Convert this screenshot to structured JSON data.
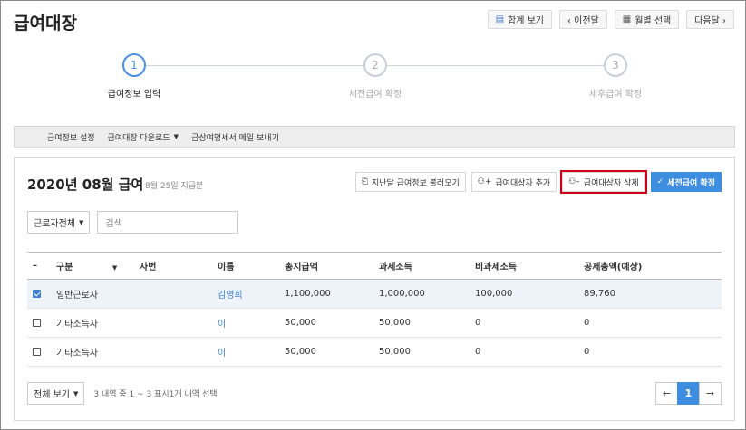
{
  "header": {
    "title": "급여대장",
    "actions": [
      {
        "label": "합계 보기",
        "icon": "sum-icon"
      },
      {
        "label": "‹ 이전달",
        "icon": ""
      },
      {
        "label": "월별 선택",
        "icon": "calendar-icon"
      },
      {
        "label": "다음달 ›",
        "icon": ""
      }
    ]
  },
  "steps": [
    {
      "num": "1",
      "label": "급여정보 입력",
      "active": true
    },
    {
      "num": "2",
      "label": "세전급여 확정",
      "active": false
    },
    {
      "num": "3",
      "label": "세후급여 확정",
      "active": false
    }
  ],
  "menubar": {
    "items": [
      "급여정보 설정",
      "급여대장 다운로드",
      "급상여명세서 메일 보내기"
    ]
  },
  "card": {
    "title": "2020년 08월 급여",
    "subtitle": "8월 25일 지급분",
    "actions": {
      "load_prev": "지난달 급여정보 불러오기",
      "add_target": "급여대상자 추가",
      "delete_target": "급여대상자 삭제",
      "confirm": "세전급여 확정"
    },
    "filter": {
      "worker_select": "근로자전체",
      "search_placeholder": "검색"
    }
  },
  "table": {
    "columns": [
      "–",
      "구분",
      "사번",
      "이름",
      "총지급액",
      "과세소득",
      "비과세소득",
      "공제총액(예상)"
    ],
    "rows": [
      {
        "checked": true,
        "type": "일반근로자",
        "emp_no": "",
        "name": "김영희",
        "total": "1,100,000",
        "taxable": "1,000,000",
        "nontaxable": "100,000",
        "deduction": "89,760"
      },
      {
        "checked": false,
        "type": "기타소득자",
        "emp_no": "",
        "name": "이",
        "total": "50,000",
        "taxable": "50,000",
        "nontaxable": "0",
        "deduction": "0"
      },
      {
        "checked": false,
        "type": "기타소득자",
        "emp_no": "",
        "name": "이",
        "total": "50,000",
        "taxable": "50,000",
        "nontaxable": "0",
        "deduction": "0"
      }
    ]
  },
  "footer": {
    "view_select": "전체 보기",
    "info": "3 내역 중 1 ~ 3 표시1개 내역 선택",
    "pager": {
      "prev": "←",
      "current": "1",
      "next": "→"
    }
  },
  "colors": {
    "accent": "#3d8ee0",
    "highlight_border": "#d0001a",
    "link": "#3d7fd0"
  }
}
